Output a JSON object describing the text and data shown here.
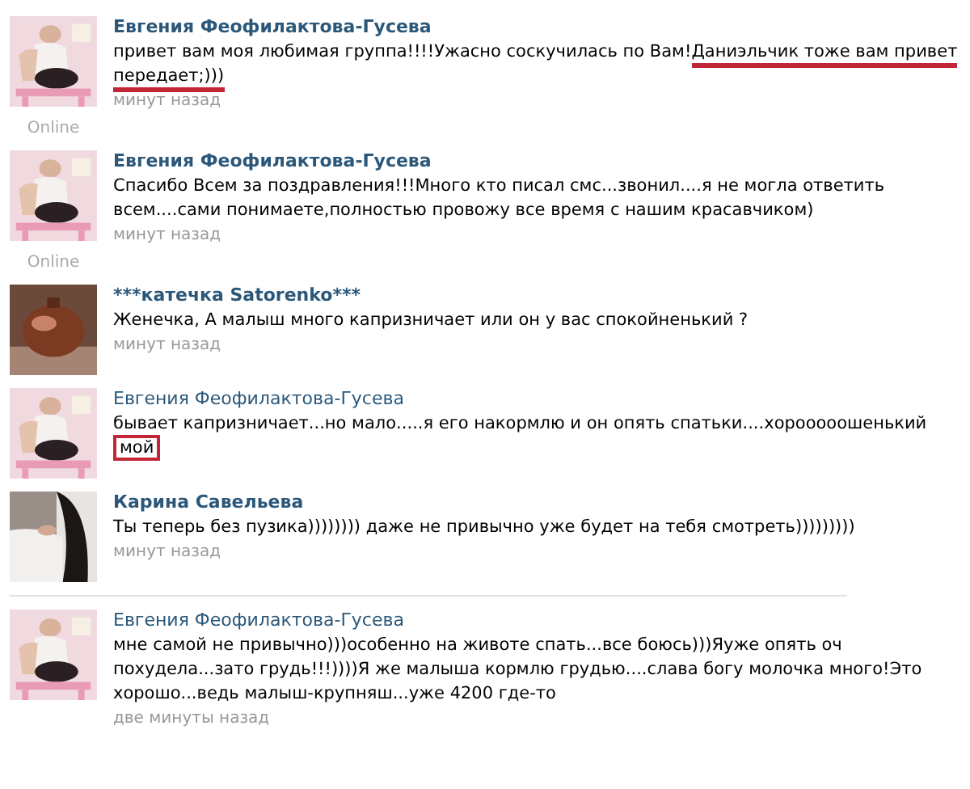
{
  "comments": [
    {
      "author": "Евгения Феофилактова-Гусева",
      "bold": true,
      "online": "Online",
      "parts": [
        {
          "text": "привет вам моя любимая группа!!!!Ужасно соскучилась по Вам!",
          "underlined": false,
          "boxed": false
        },
        {
          "text": "Даниэльчик тоже вам привет передает;)))",
          "underlined": true,
          "boxed": false
        }
      ],
      "time": "минут назад",
      "separator_after": false
    },
    {
      "author": "Евгения Феофилактова-Гусева",
      "bold": true,
      "online": "Online",
      "parts": [
        {
          "text": "Спасибо Всем за поздравления!!!Много кто писал смс...звонил....я не могла ответить всем....сами понимаете,полностью провожу все время с нашим красавчиком)",
          "underlined": false,
          "boxed": false
        }
      ],
      "time": "минут назад",
      "separator_after": false
    },
    {
      "author": "***катечка Satorenko***",
      "bold": true,
      "parts": [
        {
          "text": "Женечка, А малыш много капризничает или он у вас спокойненький ?",
          "underlined": false,
          "boxed": false
        }
      ],
      "time": "минут назад",
      "separator_after": false
    },
    {
      "author": "Евгения Феофилактова-Гусева",
      "bold": false,
      "parts": [
        {
          "text": "бывает капризничает...но мало.....я его накормлю и он опять спатьки....хорооооошенький ",
          "underlined": false,
          "boxed": false
        },
        {
          "text": "мой",
          "underlined": false,
          "boxed": true
        }
      ],
      "separator_after": false
    },
    {
      "author": "Карина Савельева",
      "bold": true,
      "parts": [
        {
          "text": "Ты теперь без пузика)))))))) даже не привычно уже будет на тебя смотреть)))))))))",
          "underlined": false,
          "boxed": false
        }
      ],
      "time": "минут назад",
      "separator_after": true
    },
    {
      "author": "Евгения Феофилактова-Гусева",
      "bold": false,
      "parts": [
        {
          "text": "мне самой не привычно)))особенно на животе спать...все боюсь)))Яуже опять оч похудела...зато грудь!!!))))Я же малыша кормлю грудью....слава богу молочка много!Это хорошо...ведь малыш-крупняш...уже 4200 где-то",
          "underlined": false,
          "boxed": false
        }
      ],
      "time": "две минуты назад",
      "separator_after": false
    }
  ]
}
